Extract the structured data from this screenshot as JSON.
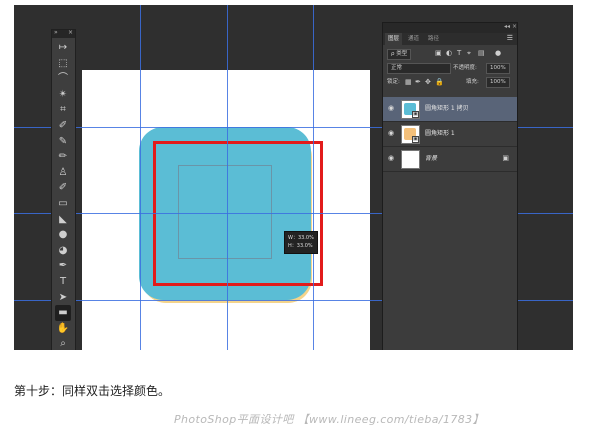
{
  "tools_panel": {
    "collapse_label": "»",
    "close_label": "×",
    "tools": [
      {
        "name": "move-tool-icon",
        "glyph": "↦"
      },
      {
        "name": "marquee-tool-icon",
        "glyph": "⬚"
      },
      {
        "name": "lasso-tool-icon",
        "glyph": "⌒"
      },
      {
        "name": "magic-wand-tool-icon",
        "glyph": "✴"
      },
      {
        "name": "crop-tool-icon",
        "glyph": "⌗"
      },
      {
        "name": "eyedropper-tool-icon",
        "glyph": "✐"
      },
      {
        "name": "healing-brush-tool-icon",
        "glyph": "✎"
      },
      {
        "name": "brush-tool-icon",
        "glyph": "✏"
      },
      {
        "name": "clone-stamp-tool-icon",
        "glyph": "♙"
      },
      {
        "name": "history-brush-tool-icon",
        "glyph": "✐"
      },
      {
        "name": "eraser-tool-icon",
        "glyph": "▭"
      },
      {
        "name": "paint-bucket-tool-icon",
        "glyph": "◣"
      },
      {
        "name": "blur-tool-icon",
        "glyph": "●"
      },
      {
        "name": "dodge-tool-icon",
        "glyph": "◕"
      },
      {
        "name": "pen-tool-icon",
        "glyph": "✒"
      },
      {
        "name": "type-tool-icon",
        "glyph": "T"
      },
      {
        "name": "path-selection-tool-icon",
        "glyph": "➤"
      },
      {
        "name": "rectangle-tool-icon",
        "glyph": "▬"
      },
      {
        "name": "hand-tool-icon",
        "glyph": "✋"
      },
      {
        "name": "zoom-tool-icon",
        "glyph": "⌕"
      }
    ]
  },
  "canvas": {
    "transform_tooltip": {
      "w_label": "W：33.0%",
      "h_label": "H：33.0%"
    },
    "colors": {
      "rounded_rect": "#5bbdd5",
      "rect_shadow": "#f4d48b",
      "selection_box": "#e21b1b",
      "guides": "#3b6fe0"
    }
  },
  "layers_panel": {
    "header_controls": "◂◂  ×",
    "tabs": [
      "图层",
      "通道",
      "路径"
    ],
    "active_tab": 0,
    "filter_kind": "ρ 类型",
    "filter_icons": [
      "image-filter-icon",
      "adjustment-filter-icon",
      "type-filter-icon",
      "shape-filter-icon",
      "smart-object-filter-icon"
    ],
    "blend_mode": "正常",
    "opacity_label": "不透明度:",
    "opacity_value": "100%",
    "lock_label": "锁定:",
    "fill_label": "填充:",
    "fill_value": "100%",
    "layers": [
      {
        "name": "圆角矩形 1 拷贝",
        "selected": true,
        "thumb": "#5bbdd5"
      },
      {
        "name": "圆角矩形 1",
        "selected": false,
        "thumb": "#f4c07a"
      },
      {
        "name": "背景",
        "selected": false,
        "thumb": "#ffffff",
        "locked": true
      }
    ]
  },
  "caption": "第十步：同样双击选择颜色。",
  "watermark": "PhotoShop平面设计吧 【www.lineeg.com/tieba/1783】"
}
